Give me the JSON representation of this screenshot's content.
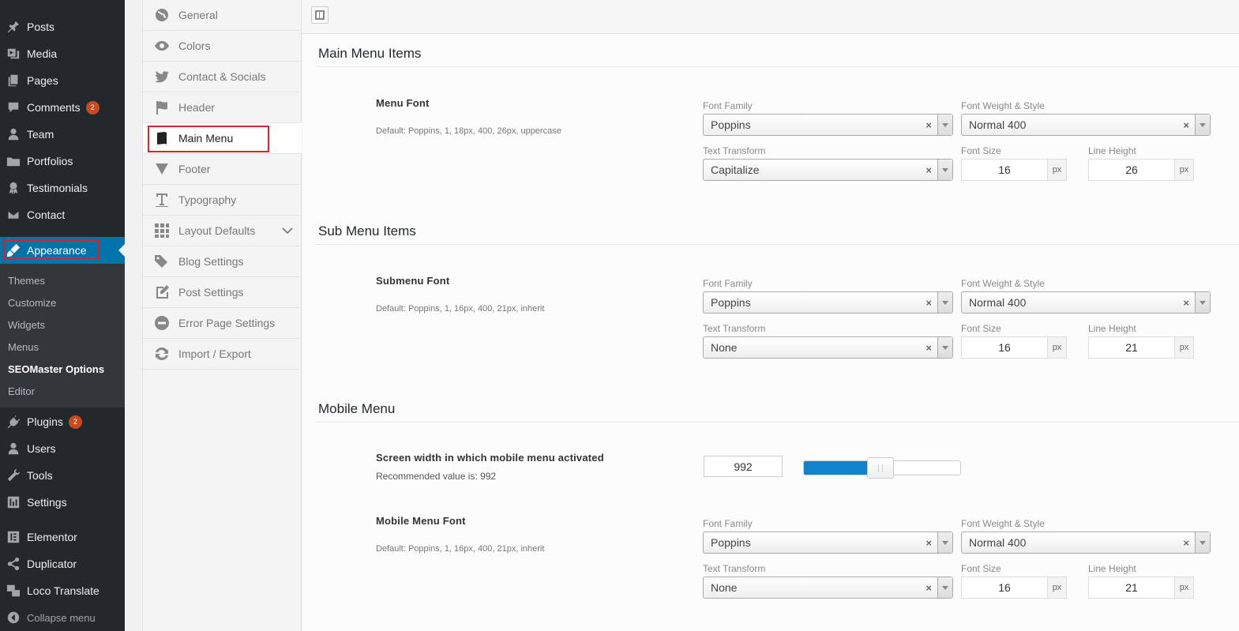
{
  "wp_sidebar": {
    "items": [
      {
        "label": "Posts",
        "icon": "pin-icon"
      },
      {
        "label": "Media",
        "icon": "media-icon"
      },
      {
        "label": "Pages",
        "icon": "pages-icon"
      },
      {
        "label": "Comments",
        "icon": "comment-icon",
        "badge": "2"
      },
      {
        "label": "Team",
        "icon": "user-icon"
      },
      {
        "label": "Portfolios",
        "icon": "folder-icon"
      },
      {
        "label": "Testimonials",
        "icon": "award-icon"
      },
      {
        "label": "Contact",
        "icon": "mail-icon"
      },
      {
        "label": "Appearance",
        "icon": "brush-icon"
      },
      {
        "label": "Plugins",
        "icon": "plug-icon",
        "badge": "2"
      },
      {
        "label": "Users",
        "icon": "user-icon"
      },
      {
        "label": "Tools",
        "icon": "wrench-icon"
      },
      {
        "label": "Settings",
        "icon": "settings-icon"
      },
      {
        "label": "Elementor",
        "icon": "elementor-icon"
      },
      {
        "label": "Duplicator",
        "icon": "share-icon"
      },
      {
        "label": "Loco Translate",
        "icon": "translate-icon"
      }
    ],
    "submenu": [
      "Themes",
      "Customize",
      "Widgets",
      "Menus",
      "SEOMaster Options",
      "Editor"
    ],
    "collapse_label": "Collapse menu"
  },
  "options_nav": {
    "items": [
      {
        "label": "General",
        "icon": "globe-icon"
      },
      {
        "label": "Colors",
        "icon": "eye-icon"
      },
      {
        "label": "Contact & Socials",
        "icon": "twitter-icon"
      },
      {
        "label": "Header",
        "icon": "flag-icon"
      },
      {
        "label": "Main Menu",
        "icon": "book-icon"
      },
      {
        "label": "Footer",
        "icon": "triangle-down-icon"
      },
      {
        "label": "Typography",
        "icon": "text-icon"
      },
      {
        "label": "Layout Defaults",
        "icon": "grid-icon"
      },
      {
        "label": "Blog Settings",
        "icon": "tags-icon"
      },
      {
        "label": "Post Settings",
        "icon": "edit-icon"
      },
      {
        "label": "Error Page Settings",
        "icon": "minus-circle-icon"
      },
      {
        "label": "Import / Export",
        "icon": "refresh-icon"
      }
    ],
    "active": "Main Menu"
  },
  "sections": {
    "main": {
      "title": "Main Menu Items",
      "field_title": "Menu Font",
      "field_desc": "Default: Poppins, 1, 18px, 400, 26px, uppercase",
      "font_family": "Poppins",
      "font_weight": "Normal 400",
      "text_transform": "Capitalize",
      "font_size": "16",
      "line_height": "26"
    },
    "sub": {
      "title": "Sub Menu Items",
      "field_title": "Submenu Font",
      "field_desc": "Default: Poppins, 1, 16px, 400, 21px, inherit",
      "font_family": "Poppins",
      "font_weight": "Normal 400",
      "text_transform": "None",
      "font_size": "16",
      "line_height": "21"
    },
    "mobile": {
      "title": "Mobile Menu",
      "width_title": "Screen width in which mobile menu activated",
      "width_desc": "Recommended value is: 992",
      "width_value": "992",
      "slider_fraction": 0.49,
      "field_title": "Mobile Menu Font",
      "field_desc": "Default: Poppins, 1, 16px, 400, 21px, inherit",
      "font_family": "Poppins",
      "font_weight": "Normal 400",
      "text_transform": "None",
      "font_size": "16",
      "line_height": "21"
    }
  },
  "labels": {
    "font_family": "Font Family",
    "font_weight": "Font Weight & Style",
    "text_transform": "Text Transform",
    "font_size": "Font Size",
    "line_height": "Line Height",
    "unit": "px",
    "clear": "×"
  },
  "colors": {
    "sidebar_bg": "#23282d",
    "active_blue": "#0073aa",
    "badge": "#ca4a1f",
    "highlight_red": "#d7232b",
    "slider_fill": "#0f83cc"
  }
}
